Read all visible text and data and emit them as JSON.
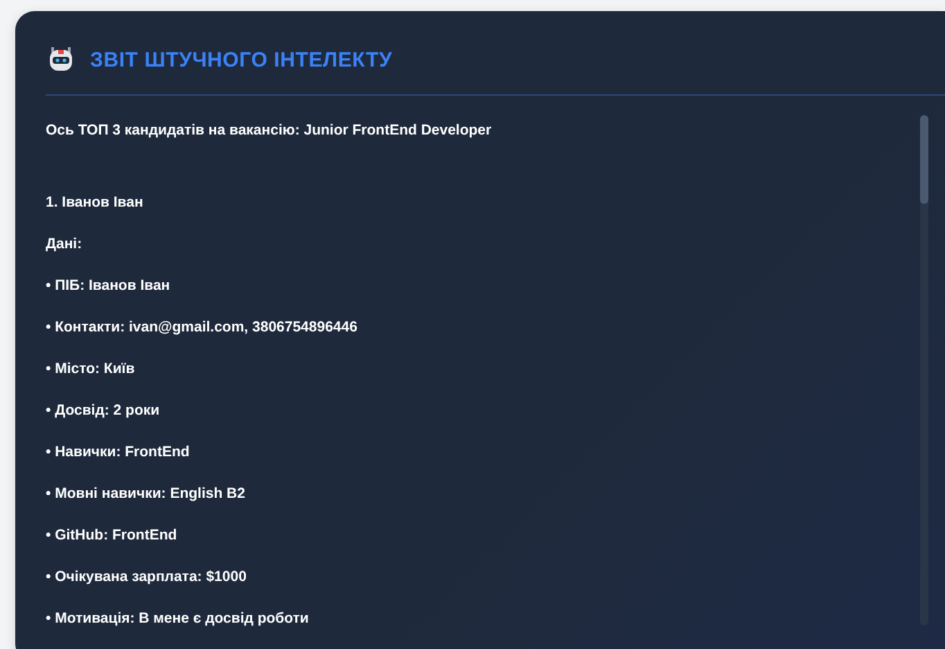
{
  "report": {
    "title": "ЗВІТ ШТУЧНОГО ІНТЕЛЕКТУ",
    "intro": "Ось ТОП 3 кандидатів на вакансію: Junior FrontEnd Developer",
    "lines": [
      "1. Іванов Іван",
      "Дані:",
      "• ПІБ: Іванов Іван",
      "• Контакти: ivan@gmail.com, 3806754896446",
      "• Місто: Київ",
      "• Досвід: 2 роки",
      "• Навички: FrontEnd",
      "• Мовні навички: English B2",
      "• GitHub: FrontEnd",
      "• Очікувана зарплата: $1000",
      "• Мотивація: В мене є досвід роботи"
    ]
  }
}
